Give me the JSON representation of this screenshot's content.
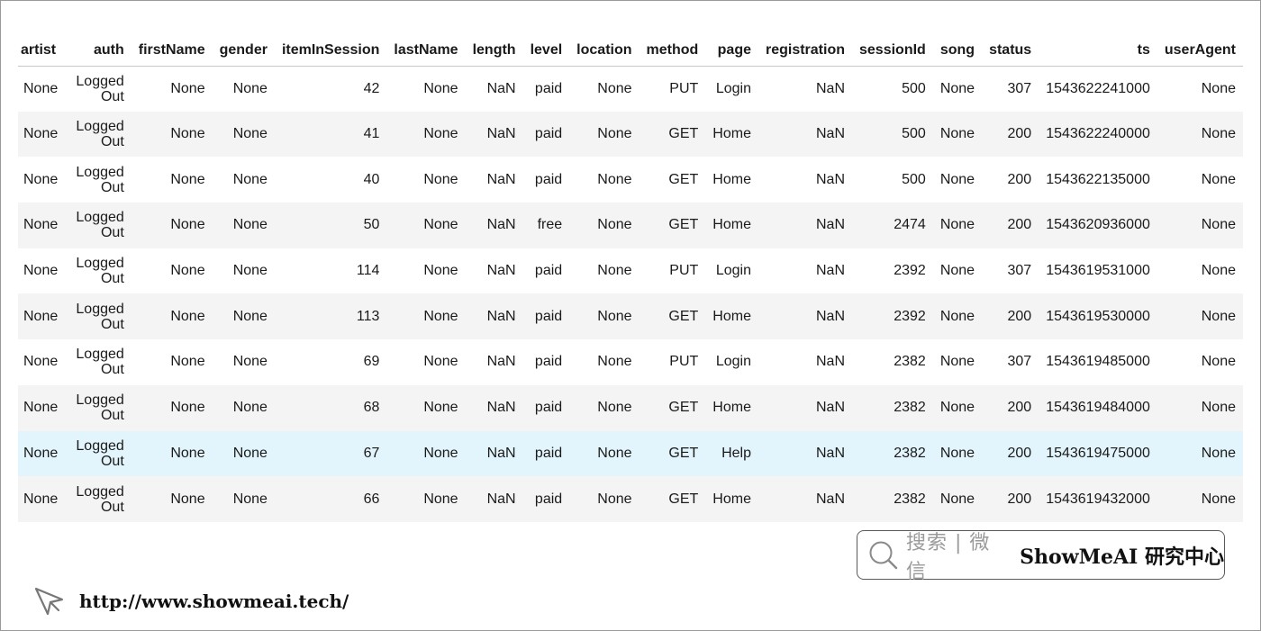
{
  "table": {
    "columns": [
      "artist",
      "auth",
      "firstName",
      "gender",
      "itemInSession",
      "lastName",
      "length",
      "level",
      "location",
      "method",
      "page",
      "registration",
      "sessionId",
      "song",
      "status",
      "ts",
      "userAgent"
    ],
    "rows": [
      [
        "None",
        "Logged Out",
        "None",
        "None",
        "42",
        "None",
        "NaN",
        "paid",
        "None",
        "PUT",
        "Login",
        "NaN",
        "500",
        "None",
        "307",
        "1543622241000",
        "None"
      ],
      [
        "None",
        "Logged Out",
        "None",
        "None",
        "41",
        "None",
        "NaN",
        "paid",
        "None",
        "GET",
        "Home",
        "NaN",
        "500",
        "None",
        "200",
        "1543622240000",
        "None"
      ],
      [
        "None",
        "Logged Out",
        "None",
        "None",
        "40",
        "None",
        "NaN",
        "paid",
        "None",
        "GET",
        "Home",
        "NaN",
        "500",
        "None",
        "200",
        "1543622135000",
        "None"
      ],
      [
        "None",
        "Logged Out",
        "None",
        "None",
        "50",
        "None",
        "NaN",
        "free",
        "None",
        "GET",
        "Home",
        "NaN",
        "2474",
        "None",
        "200",
        "1543620936000",
        "None"
      ],
      [
        "None",
        "Logged Out",
        "None",
        "None",
        "114",
        "None",
        "NaN",
        "paid",
        "None",
        "PUT",
        "Login",
        "NaN",
        "2392",
        "None",
        "307",
        "1543619531000",
        "None"
      ],
      [
        "None",
        "Logged Out",
        "None",
        "None",
        "113",
        "None",
        "NaN",
        "paid",
        "None",
        "GET",
        "Home",
        "NaN",
        "2392",
        "None",
        "200",
        "1543619530000",
        "None"
      ],
      [
        "None",
        "Logged Out",
        "None",
        "None",
        "69",
        "None",
        "NaN",
        "paid",
        "None",
        "PUT",
        "Login",
        "NaN",
        "2382",
        "None",
        "307",
        "1543619485000",
        "None"
      ],
      [
        "None",
        "Logged Out",
        "None",
        "None",
        "68",
        "None",
        "NaN",
        "paid",
        "None",
        "GET",
        "Home",
        "NaN",
        "2382",
        "None",
        "200",
        "1543619484000",
        "None"
      ],
      [
        "None",
        "Logged Out",
        "None",
        "None",
        "67",
        "None",
        "NaN",
        "paid",
        "None",
        "GET",
        "Help",
        "NaN",
        "2382",
        "None",
        "200",
        "1543619475000",
        "None"
      ],
      [
        "None",
        "Logged Out",
        "None",
        "None",
        "66",
        "None",
        "NaN",
        "paid",
        "None",
        "GET",
        "Home",
        "NaN",
        "2382",
        "None",
        "200",
        "1543619432000",
        "None"
      ]
    ],
    "highlighted_row": 8
  },
  "brand": {
    "search_text": "搜索 | 微信",
    "name": "ShowMeAI 研究中心",
    "search_icon": "magnifier-icon"
  },
  "footer": {
    "url": "http://www.showmeai.tech/",
    "cursor_icon": "cursor-arrow-icon"
  },
  "colors": {
    "stripe": "#f4f4f4",
    "hover_row": "#e3f5fc",
    "border": "#c8c8c8"
  }
}
